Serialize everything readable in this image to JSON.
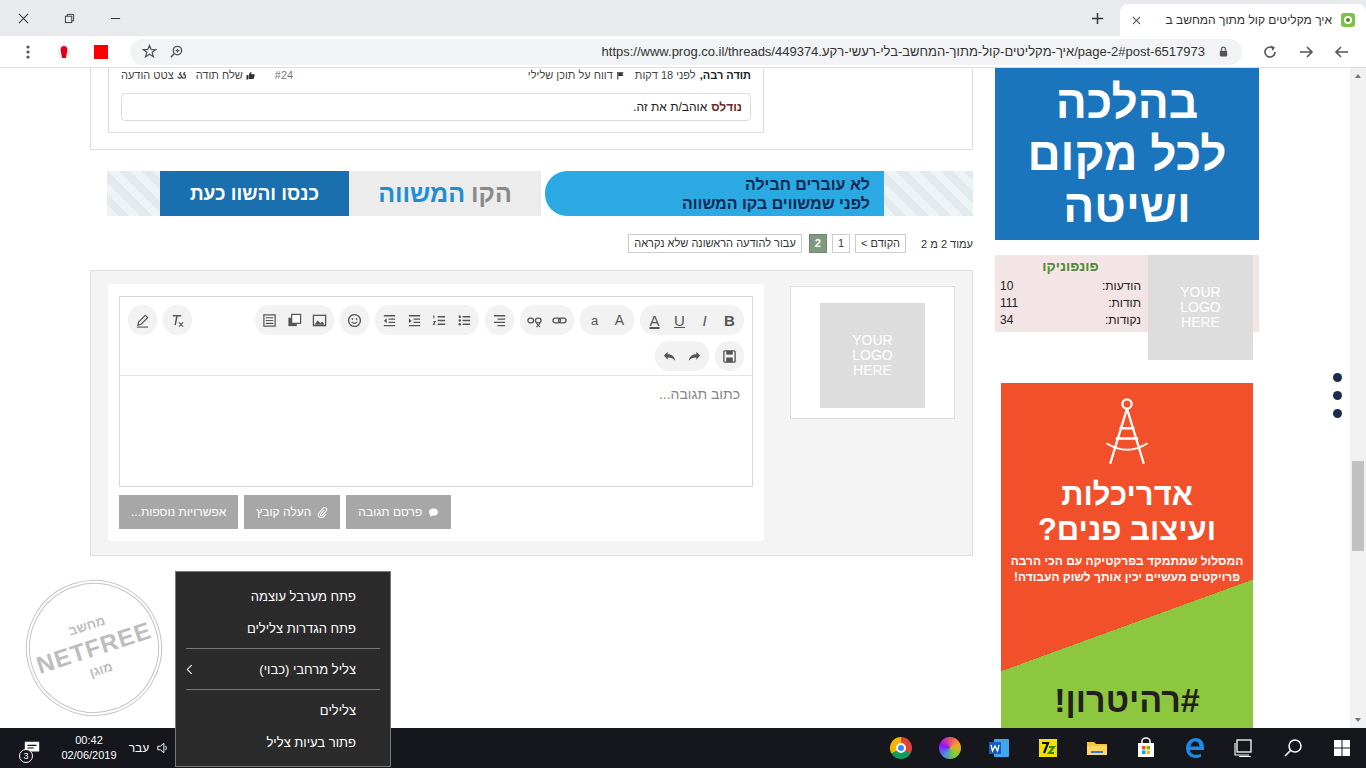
{
  "browser": {
    "tab": {
      "title": "איך מקליטים קול מתוך המחשב ב",
      "selected": true
    },
    "url": "https://www.prog.co.il/threads/449374.איך-מקליטים-קול-מתוך-המחשב-בלי-רעשי-רקע/page-2#post-6517973"
  },
  "post": {
    "author": "תודה רבה,",
    "time": "לפני 18 דקות",
    "report": "דווח על תוכן שלילי",
    "number": "#24",
    "thanks": "שלח תודה",
    "quote": "צטט הודעה",
    "like_user": "נודלס",
    "like_text": "אוהב/ת את זה."
  },
  "banner": {
    "slogan": [
      "לא עוברים חבילה",
      "לפני שמשווים בקו המשווה"
    ],
    "brand": [
      "הקו",
      "המשווה"
    ],
    "cta": "כנסו והשוו כעת"
  },
  "pagination": {
    "label": "עמוד 2 מ 2",
    "prev": "< הקודם",
    "pages": [
      {
        "label": "1",
        "selected": false
      },
      {
        "label": "2",
        "selected": true
      }
    ],
    "jump": "עבור להודעה הראשונה שלא נקראה"
  },
  "editor": {
    "avatar": "YOUR LOGO HERE",
    "toolbar_letters": [
      {
        "glyph": "B",
        "kind": "bold"
      },
      {
        "glyph": "I",
        "kind": "italic"
      },
      {
        "glyph": "U",
        "kind": "underline"
      },
      {
        "glyph": "A",
        "kind": "color"
      },
      {
        "glyph": "A",
        "kind": "size"
      },
      {
        "glyph": "a",
        "kind": "font"
      }
    ],
    "placeholder": "כתוב תגובה...",
    "buttons": [
      {
        "label": "פרסם תגובה",
        "kind": "post"
      },
      {
        "label": "העלה קובץ",
        "kind": "upload"
      },
      {
        "label": "אפשרויות נוספות...",
        "kind": "more"
      }
    ]
  },
  "sidebar": {
    "ad_top": [
      "בהלכה",
      "לכל מקום",
      "ושיטה"
    ],
    "user": {
      "name": "פונפוניקו",
      "logo": "YOUR LOGO HERE",
      "stats": [
        {
          "label": "הודעות:",
          "value": "10"
        },
        {
          "label": "תודות:",
          "value": "111"
        },
        {
          "label": "נקודות:",
          "value": "34"
        }
      ]
    },
    "ad_bottom": {
      "title": [
        "אדריכלות",
        "ועיצוב פנים?"
      ],
      "body": [
        "המסלול שמתמקד בפרקטיקה עם הכי הרבה",
        "פרויקטים מעשיים יכין אותך לשוק העבודה!"
      ],
      "tag": "#רהיטרון!"
    }
  },
  "scrollbar": {
    "level": 0.7
  },
  "watermark": {
    "top": "מחשב",
    "brand": "NETFREE",
    "bottom": "מוגן"
  },
  "context_menu": [
    {
      "kind": "item",
      "label": "פתח מערבל עוצמה"
    },
    {
      "kind": "item",
      "label": "פתח הגדרות צלילים"
    },
    {
      "kind": "separator"
    },
    {
      "kind": "submenu",
      "label": "צליל מרחבי (כבוי)"
    },
    {
      "kind": "separator"
    },
    {
      "kind": "item",
      "label": "צלילים"
    },
    {
      "kind": "item",
      "label": "פתור בעיות צליל"
    }
  ],
  "taskbar": {
    "notifications": "3",
    "time": "00:42",
    "date": "02/06/2019",
    "language": "עבר"
  }
}
